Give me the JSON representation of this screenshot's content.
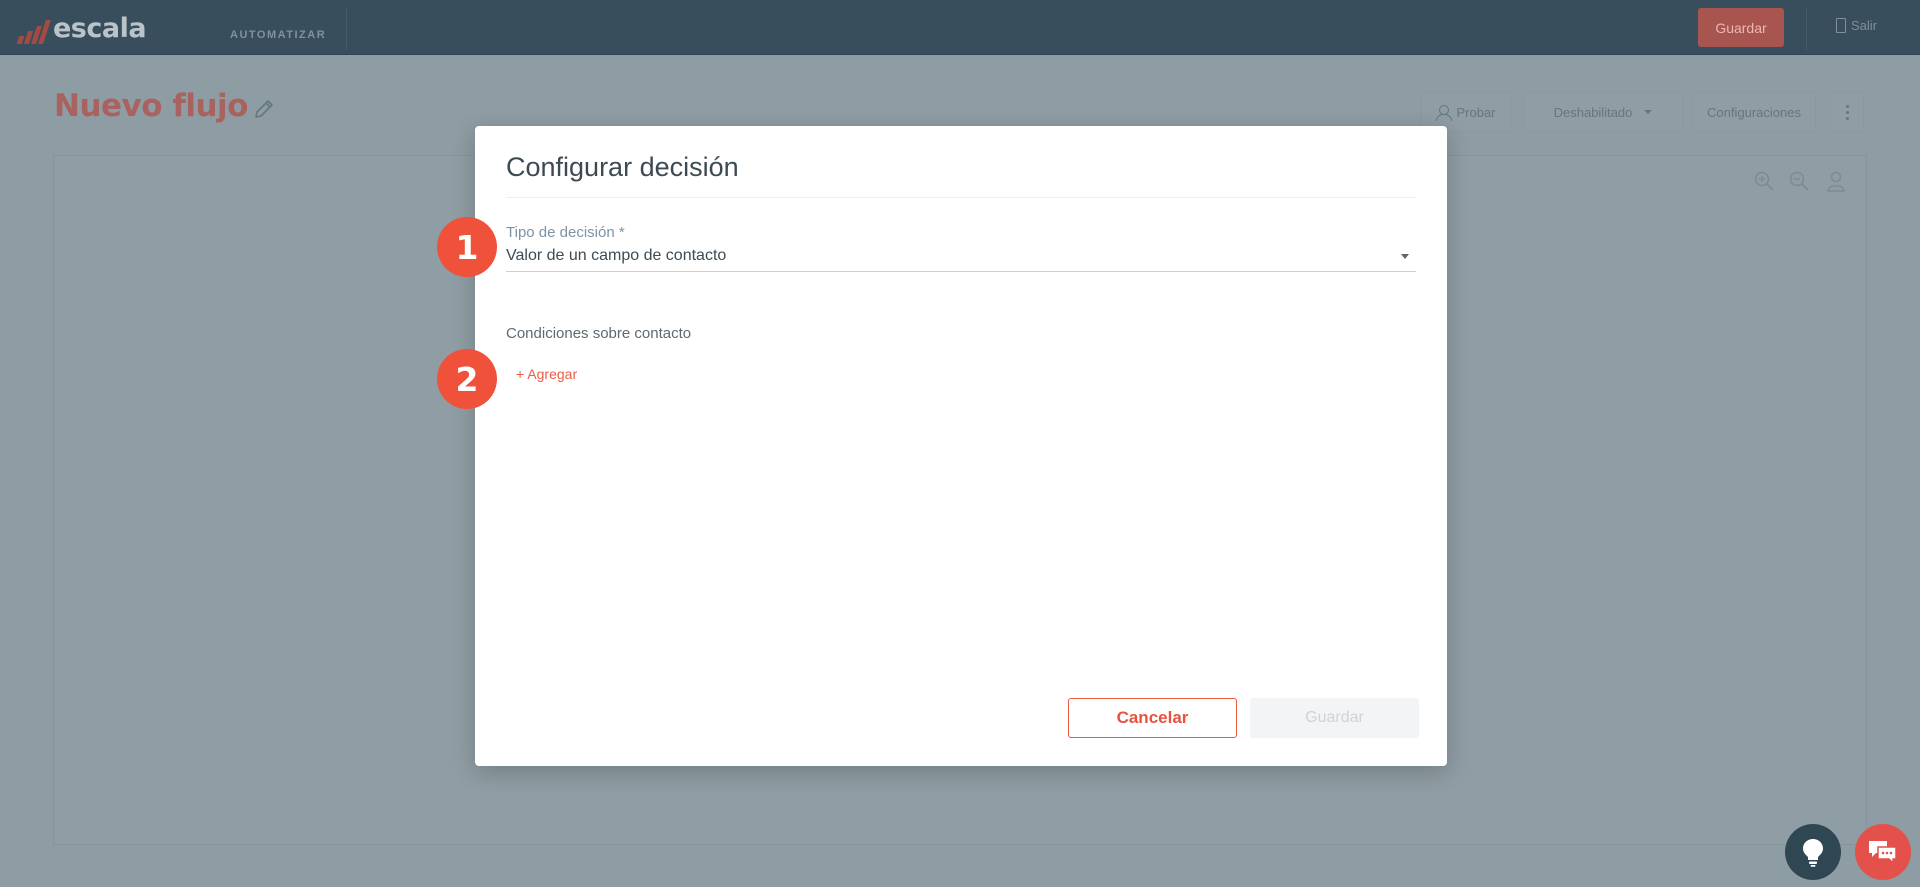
{
  "app": {
    "brand": "escala",
    "module": "AUTOMATIZAR"
  },
  "topbar": {
    "save_label": "Guardar",
    "exit_label": "Salir"
  },
  "page": {
    "title": "Nuevo flujo"
  },
  "header_actions": {
    "test_label": "Probar",
    "status_label": "Deshabilitado",
    "settings_label": "Configuraciones"
  },
  "modal": {
    "title": "Configurar decisión",
    "decision_type_label": "Tipo de decisión *",
    "decision_type_value": "Valor de un campo de contacto",
    "conditions_label": "Condiciones sobre contacto",
    "add_label": "+ Agregar",
    "cancel_label": "Cancelar",
    "save_label": "Guardar"
  },
  "markers": {
    "step1": "1",
    "step2": "2"
  },
  "colors": {
    "topbar": "#384e5c",
    "overlay": "#8e9ca3",
    "accent": "#ec5b45",
    "marker": "#f0513a",
    "modal_bg": "#ffffff"
  }
}
